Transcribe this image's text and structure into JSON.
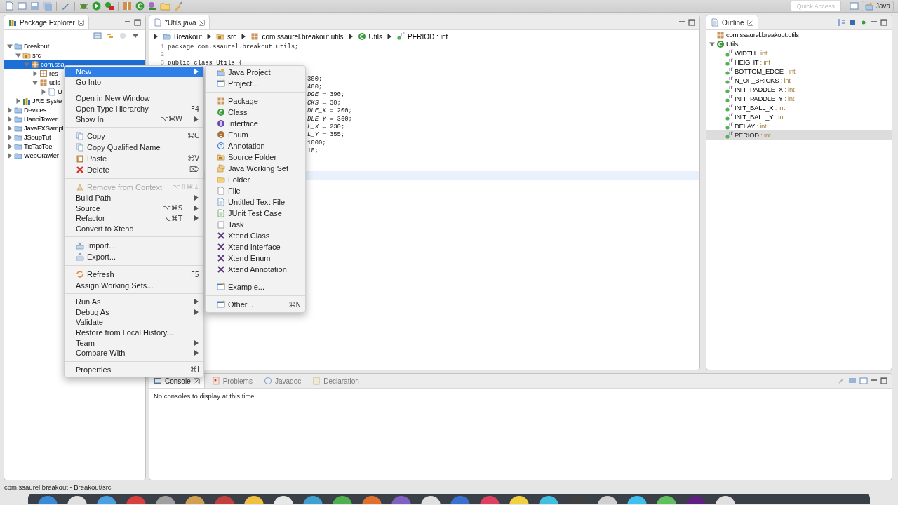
{
  "toolbar": {
    "quick_access": {
      "placeholder": "Quick Access"
    },
    "perspective": {
      "label": "Java",
      "selected": true
    }
  },
  "package_explorer": {
    "title": "Package Explorer",
    "tree": [
      {
        "label": "Breakout",
        "kind": "project",
        "expanded": true,
        "selected": false,
        "children": [
          {
            "label": "src",
            "kind": "src",
            "expanded": true,
            "selected": false,
            "children": [
              {
                "label": "com.ssa",
                "kind": "package",
                "expanded": true,
                "selected": true,
                "children": [
                  {
                    "label": "res",
                    "kind": "package-empty",
                    "expanded": false,
                    "selected": false
                  },
                  {
                    "label": "utils",
                    "kind": "package",
                    "expanded": true,
                    "selected": false,
                    "children": [
                      {
                        "label": "U",
                        "kind": "java-file",
                        "expanded": false,
                        "selected": false
                      }
                    ]
                  }
                ]
              }
            ]
          },
          {
            "label": "JRE Syste",
            "kind": "library",
            "expanded": false,
            "selected": false
          }
        ]
      },
      {
        "label": "Devices",
        "kind": "project",
        "expanded": false,
        "selected": false
      },
      {
        "label": "HanoiTower",
        "kind": "project",
        "expanded": false,
        "selected": false
      },
      {
        "label": "JavaFXSampl",
        "kind": "project",
        "expanded": false,
        "selected": false
      },
      {
        "label": "JSoupTut",
        "kind": "project",
        "expanded": false,
        "selected": false
      },
      {
        "label": "TicTacToe",
        "kind": "project",
        "expanded": false,
        "selected": false
      },
      {
        "label": "WebCrawler",
        "kind": "project",
        "expanded": false,
        "selected": false
      }
    ]
  },
  "editor": {
    "tab": {
      "label": "*Utils.java",
      "selected": true
    },
    "breadcrumb": [
      {
        "label": "Breakout",
        "kind": "project"
      },
      {
        "label": "src",
        "kind": "src"
      },
      {
        "label": "com.ssaurel.breakout.utils",
        "kind": "package"
      },
      {
        "label": "Utils",
        "kind": "class"
      },
      {
        "label": "PERIOD : int",
        "kind": "field"
      }
    ],
    "lines": [
      {
        "number": "1",
        "text": "package com.ssaurel.breakout.utils;"
      },
      {
        "number": "2"
      },
      {
        "number": "3",
        "text": "public class Utils {"
      }
    ],
    "fragments": [
      "300;",
      "400;",
      "*DGE* = 390;",
      "*CKS* = 30;",
      "*DLE_X* = 200;",
      "*DLE_Y* = 360;",
      "*L_X* = 230;",
      "*L_Y* = 355;",
      "1000;",
      "10;"
    ]
  },
  "outline": {
    "title": "Outline",
    "tree": [
      {
        "label": "com.ssaurel.breakout.utils",
        "kind": "package",
        "selected": false
      },
      {
        "label": "Utils",
        "kind": "class",
        "expanded": true,
        "selected": false,
        "children": [
          {
            "label": "WIDTH",
            "type": ": int",
            "kind": "field",
            "selected": false
          },
          {
            "label": "HEIGHT",
            "type": ": int",
            "kind": "field",
            "selected": false
          },
          {
            "label": "BOTTOM_EDGE",
            "type": ": int",
            "kind": "field",
            "selected": false
          },
          {
            "label": "N_OF_BRICKS",
            "type": ": int",
            "kind": "field",
            "selected": false
          },
          {
            "label": "INIT_PADDLE_X",
            "type": ": int",
            "kind": "field",
            "selected": false
          },
          {
            "label": "INIT_PADDLE_Y",
            "type": ": int",
            "kind": "field",
            "selected": false
          },
          {
            "label": "INIT_BALL_X",
            "type": ": int",
            "kind": "field",
            "selected": false
          },
          {
            "label": "INIT_BALL_Y",
            "type": ": int",
            "kind": "field",
            "selected": false
          },
          {
            "label": "DELAY",
            "type": ": int",
            "kind": "field",
            "selected": false
          },
          {
            "label": "PERIOD",
            "type": ": int",
            "kind": "field",
            "selected": true
          }
        ]
      }
    ]
  },
  "console": {
    "tabs": [
      {
        "label": "Console",
        "kind": "console",
        "selected": true
      },
      {
        "label": "Problems",
        "kind": "problems",
        "selected": false
      },
      {
        "label": "Javadoc",
        "kind": "javadoc",
        "selected": false
      },
      {
        "label": "Declaration",
        "kind": "declaration",
        "selected": false
      }
    ],
    "message": "No consoles to display at this time."
  },
  "status_bar": {
    "text": "com.ssaurel.breakout - Breakout/src"
  },
  "context_menu": {
    "groups": [
      [
        {
          "label": "New",
          "kind": "plain",
          "has_submenu": true,
          "selected": true,
          "disabled": false
        },
        {
          "label": "Go Into",
          "kind": "plain",
          "has_submenu": false,
          "selected": false,
          "disabled": false
        }
      ],
      [
        {
          "label": "Open in New Window",
          "kind": "plain",
          "has_submenu": false,
          "selected": false,
          "disabled": false
        },
        {
          "label": "Open Type Hierarchy",
          "kind": "plain",
          "shortcut": "F4",
          "has_submenu": false,
          "selected": false,
          "disabled": false
        },
        {
          "label": "Show In",
          "kind": "plain",
          "shortcut": "⌥⌘W",
          "has_submenu": true,
          "selected": false,
          "disabled": false
        }
      ],
      [
        {
          "label": "Copy",
          "kind": "copy",
          "shortcut": "⌘C",
          "has_submenu": false,
          "selected": false,
          "disabled": false
        },
        {
          "label": "Copy Qualified Name",
          "kind": "copy",
          "has_submenu": false,
          "selected": false,
          "disabled": false
        },
        {
          "label": "Paste",
          "kind": "paste",
          "shortcut": "⌘V",
          "has_submenu": false,
          "selected": false,
          "disabled": false
        },
        {
          "label": "Delete",
          "kind": "delete",
          "shortcut": "⌦",
          "has_submenu": false,
          "selected": false,
          "disabled": false
        }
      ],
      [
        {
          "label": "Remove from Context",
          "kind": "remove",
          "shortcut": "⌥⇧⌘↓",
          "has_submenu": false,
          "selected": false,
          "disabled": true
        },
        {
          "label": "Build Path",
          "kind": "plain",
          "has_submenu": true,
          "selected": false,
          "disabled": false
        },
        {
          "label": "Source",
          "kind": "plain",
          "shortcut": "⌥⌘S",
          "has_submenu": true,
          "selected": false,
          "disabled": false
        },
        {
          "label": "Refactor",
          "kind": "plain",
          "shortcut": "⌥⌘T",
          "has_submenu": true,
          "selected": false,
          "disabled": false
        },
        {
          "label": "Convert to Xtend",
          "kind": "plain",
          "has_submenu": false,
          "selected": false,
          "disabled": false
        }
      ],
      [
        {
          "label": "Import...",
          "kind": "import",
          "has_submenu": false,
          "selected": false,
          "disabled": false
        },
        {
          "label": "Export...",
          "kind": "export",
          "has_submenu": false,
          "selected": false,
          "disabled": false
        }
      ],
      [
        {
          "label": "Refresh",
          "kind": "refresh",
          "shortcut": "F5",
          "has_submenu": false,
          "selected": false,
          "disabled": false
        },
        {
          "label": "Assign Working Sets...",
          "kind": "plain",
          "has_submenu": false,
          "selected": false,
          "disabled": false
        }
      ],
      [
        {
          "label": "Run As",
          "kind": "plain",
          "has_submenu": true,
          "selected": false,
          "disabled": false
        },
        {
          "label": "Debug As",
          "kind": "plain",
          "has_submenu": true,
          "selected": false,
          "disabled": false
        },
        {
          "label": "Validate",
          "kind": "plain",
          "has_submenu": false,
          "selected": false,
          "disabled": false
        },
        {
          "label": "Restore from Local History...",
          "kind": "plain",
          "has_submenu": false,
          "selected": false,
          "disabled": false
        },
        {
          "label": "Team",
          "kind": "plain",
          "has_submenu": true,
          "selected": false,
          "disabled": false
        },
        {
          "label": "Compare With",
          "kind": "plain",
          "has_submenu": true,
          "selected": false,
          "disabled": false
        }
      ],
      [
        {
          "label": "Properties",
          "kind": "plain",
          "shortcut": "⌘I",
          "has_submenu": false,
          "selected": false,
          "disabled": false
        }
      ]
    ]
  },
  "submenu": {
    "groups": [
      [
        {
          "label": "Java Project",
          "kind": "java-project",
          "selected": false
        },
        {
          "label": "Project...",
          "kind": "wizard",
          "selected": false
        }
      ],
      [
        {
          "label": "Package",
          "kind": "package",
          "selected": false
        },
        {
          "label": "Class",
          "kind": "class",
          "selected": false
        },
        {
          "label": "Interface",
          "kind": "interface",
          "selected": false
        },
        {
          "label": "Enum",
          "kind": "enum",
          "selected": false
        },
        {
          "label": "Annotation",
          "kind": "annotation",
          "selected": false
        },
        {
          "label": "Source Folder",
          "kind": "src",
          "selected": false
        },
        {
          "label": "Java Working Set",
          "kind": "working-set",
          "selected": false
        },
        {
          "label": "Folder",
          "kind": "folder",
          "selected": false
        },
        {
          "label": "File",
          "kind": "file",
          "selected": false
        },
        {
          "label": "Untitled Text File",
          "kind": "text-file",
          "selected": false
        },
        {
          "label": "JUnit Test Case",
          "kind": "junit",
          "selected": false
        },
        {
          "label": "Task",
          "kind": "task",
          "selected": false
        },
        {
          "label": "Xtend Class",
          "kind": "xtend",
          "selected": false
        },
        {
          "label": "Xtend Interface",
          "kind": "xtend",
          "selected": false
        },
        {
          "label": "Xtend Enum",
          "kind": "xtend",
          "selected": false
        },
        {
          "label": "Xtend Annotation",
          "kind": "xtend",
          "selected": false
        }
      ],
      [
        {
          "label": "Example...",
          "kind": "wizard",
          "selected": false
        }
      ],
      [
        {
          "label": "Other...",
          "kind": "wizard",
          "shortcut": "⌘N",
          "selected": false
        }
      ]
    ]
  }
}
